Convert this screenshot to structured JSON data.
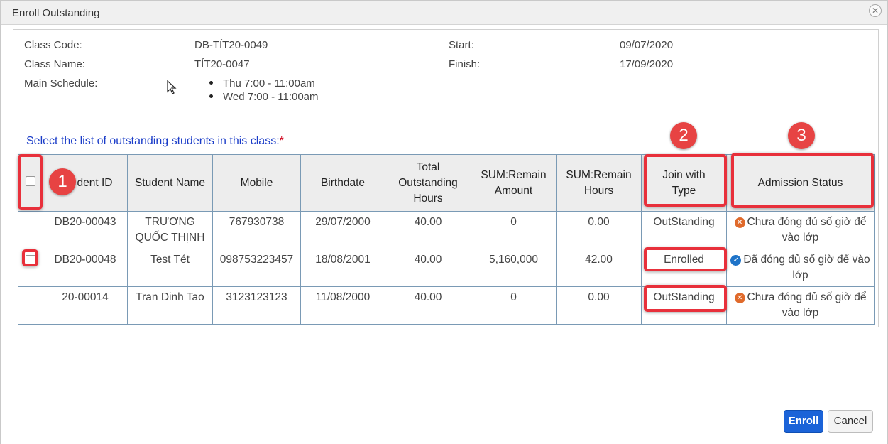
{
  "dialog": {
    "title": "Enroll Outstanding",
    "close_glyph": "✕"
  },
  "info": {
    "class_code_label": "Class Code:",
    "class_code": "DB-TÍT20-0049",
    "class_name_label": "Class Name:",
    "class_name": "TÍT20-0047",
    "schedule_label": "Main Schedule:",
    "schedule": [
      "Thu 7:00 - 11:00am",
      "Wed 7:00 - 11:00am"
    ],
    "start_label": "Start:",
    "start": "09/07/2020",
    "finish_label": "Finish:",
    "finish": "17/09/2020"
  },
  "select_label": "Select the list of outstanding students in this class:",
  "required_mark": "*",
  "table": {
    "headers": [
      "Student ID",
      "Student Name",
      "Mobile",
      "Birthdate",
      "Total Outstanding Hours",
      "SUM:Remain Amount",
      "SUM:Remain Hours",
      "Join with Type",
      "Admission Status"
    ],
    "header_visible_id": "dent ID",
    "rows": [
      {
        "id": "DB20-00043",
        "name": "TRƯƠNG QUỐC THỊNH",
        "mobile": "767930738",
        "birthdate": "29/07/2000",
        "total_hours": "40.00",
        "remain_amount": "0",
        "remain_hours": "0.00",
        "type": "OutStanding",
        "status": "Chưa đóng đủ số giờ để vào lớp",
        "status_kind": "x-icon"
      },
      {
        "id": "DB20-00048",
        "name": "Test Tét",
        "mobile": "098753223457",
        "birthdate": "18/08/2001",
        "total_hours": "40.00",
        "remain_amount": "5,160,000",
        "remain_hours": "42.00",
        "type": "Enrolled",
        "status": "Đã đóng đủ số giờ để vào lớp",
        "status_kind": "check-icon"
      },
      {
        "id": "20-00014",
        "name": "Tran Dinh Tao",
        "mobile": "3123123123",
        "birthdate": "11/08/2000",
        "total_hours": "40.00",
        "remain_amount": "0",
        "remain_hours": "0.00",
        "type": "OutStanding",
        "status": "Chưa đóng đủ số giờ để vào lớp",
        "status_kind": "x-icon"
      }
    ]
  },
  "badges": [
    "1",
    "2",
    "3"
  ],
  "footer": {
    "enroll_label": "Enroll",
    "cancel_label": "Cancel"
  },
  "colors": {
    "outstanding": "#f0a04b",
    "enrolled": "#4a8a3a",
    "annotation_red": "#e8303b",
    "enroll_button": "#1b63d8"
  }
}
